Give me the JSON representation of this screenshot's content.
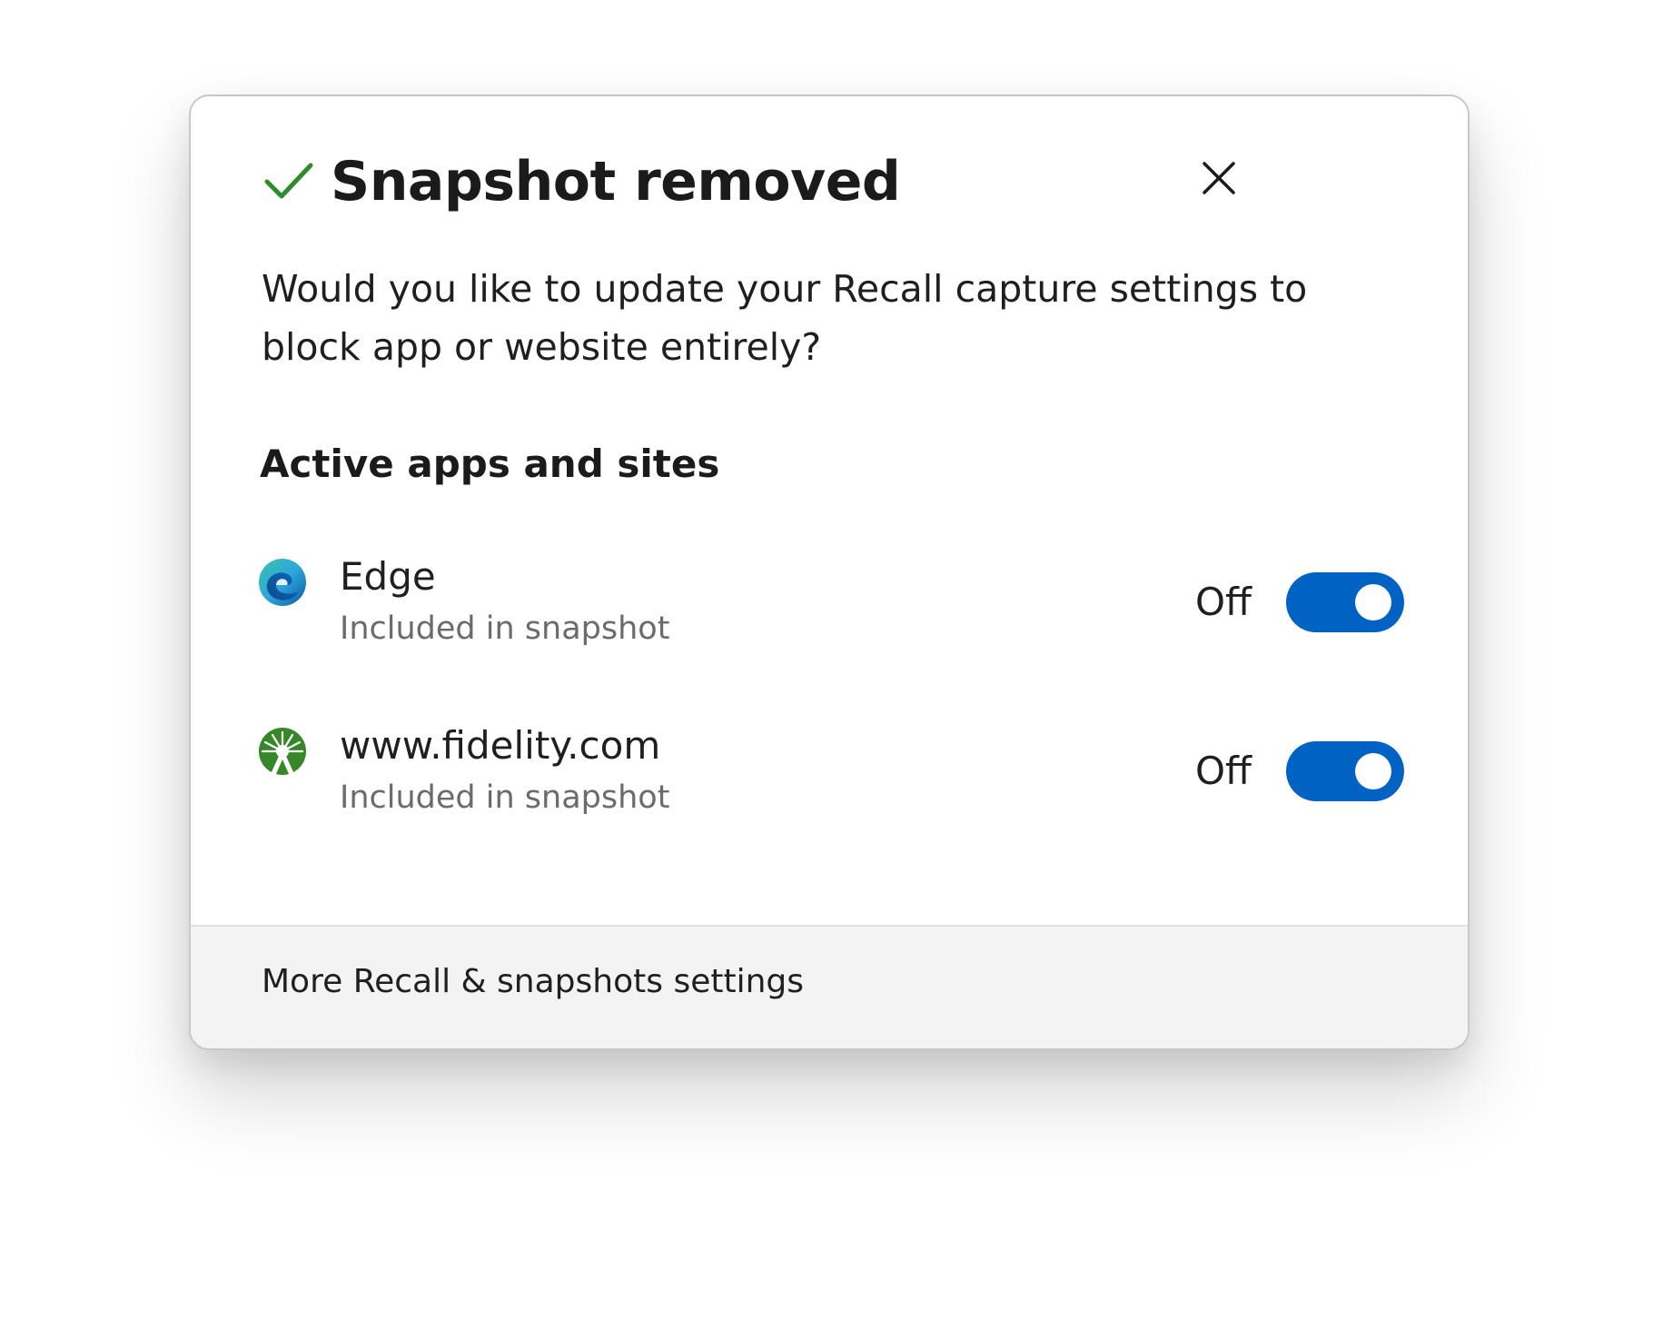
{
  "dialog": {
    "title": "Snapshot removed",
    "title_icon": "checkmark-icon",
    "close_icon": "close-icon",
    "description": "Would you like to update your Recall capture settings to block app or website entirely?",
    "section_heading": "Active apps and sites",
    "apps": [
      {
        "name": "Edge",
        "status": "Included in snapshot",
        "icon": "edge-icon",
        "toggle_label": "Off",
        "toggle_on": true
      },
      {
        "name": "www.fidelity.com",
        "status": "Included in snapshot",
        "icon": "fidelity-icon",
        "toggle_label": "Off",
        "toggle_on": true
      }
    ],
    "footer_link": "More Recall & snapshots settings"
  },
  "colors": {
    "accent": "#0063c4",
    "success": "#2e8b2e"
  }
}
